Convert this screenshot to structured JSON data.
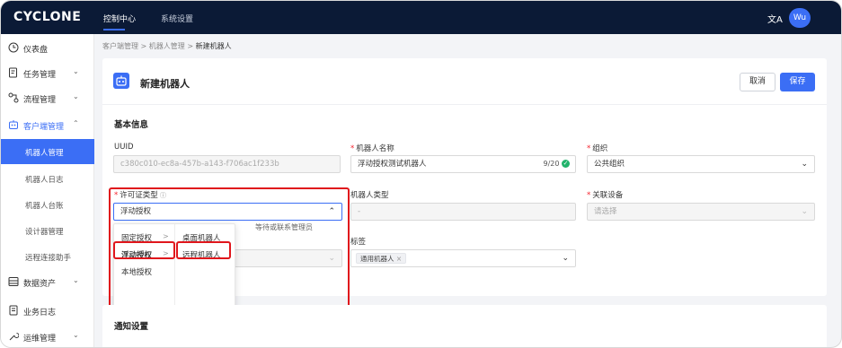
{
  "app": {
    "logo": "CYCLONE",
    "avatar": "Wu",
    "translate_icon": "文A"
  },
  "topnav": [
    {
      "label": "控制中心"
    },
    {
      "label": "系统设置"
    }
  ],
  "sidebar": {
    "items": [
      {
        "label": "仪表盘"
      },
      {
        "label": "任务管理"
      },
      {
        "label": "流程管理"
      },
      {
        "label": "客户端管理"
      },
      {
        "label": "数据资产"
      },
      {
        "label": "业务日志"
      },
      {
        "label": "运维管理"
      }
    ],
    "sub": [
      {
        "label": "机器人管理"
      },
      {
        "label": "机器人日志"
      },
      {
        "label": "机器人台账"
      },
      {
        "label": "设计器管理"
      },
      {
        "label": "远程连接助手"
      }
    ],
    "chevron_down": "⌄",
    "chevron_up": "⌃"
  },
  "breadcrumb": {
    "parts": [
      "客户端管理",
      ">",
      "机器人管理",
      ">"
    ],
    "current": "新建机器人"
  },
  "page": {
    "title": "新建机器人",
    "cancel": "取消",
    "save": "保存"
  },
  "form": {
    "section": "基本信息",
    "uuid": {
      "label": "UUID",
      "value": "c380c010-ec8a-457b-a143-f706ac1f233b"
    },
    "name": {
      "label": "机器人名称",
      "value": "浮动授权测试机器人",
      "count": "9/20"
    },
    "org": {
      "label": "组织",
      "value": "公共组织"
    },
    "license": {
      "label": "许可证类型",
      "value": "浮动授权",
      "helper": "等待或联系管理员"
    },
    "robot_type": {
      "label": "机器人类型",
      "value": "-"
    },
    "device": {
      "label": "关联设备",
      "placeholder": "请选择"
    },
    "tags": {
      "label": "标签",
      "tag": "通用机器人",
      "tag_close": "×"
    }
  },
  "dropdown": {
    "col1": [
      "固定授权",
      "浮动授权",
      "本地授权"
    ],
    "col2": [
      "桌面机器人",
      "远程机器人"
    ],
    "arrow": ">"
  },
  "notify": {
    "title": "通知设置"
  }
}
